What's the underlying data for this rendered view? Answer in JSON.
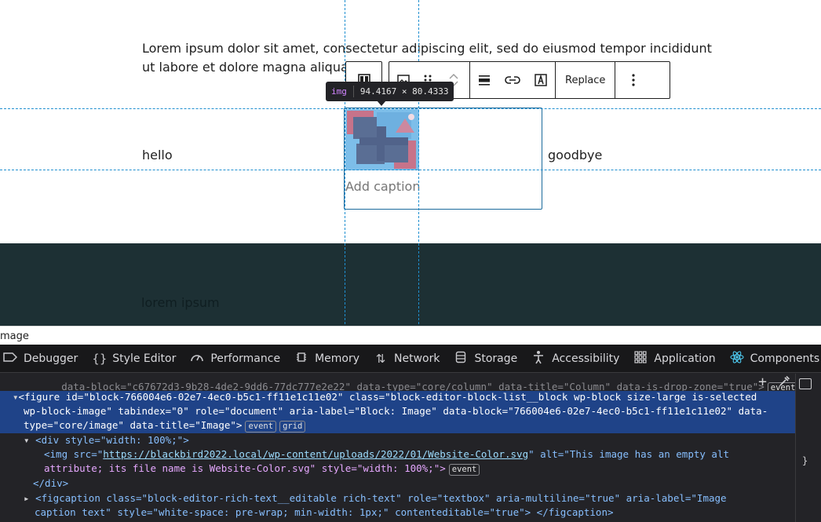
{
  "editor": {
    "paragraph": "Lorem ipsum dolor sit amet, consectetur adipiscing elit, sed do eiusmod tempor incididunt ut labore et dolore magna aliqua.",
    "left_column_text": "hello",
    "right_column_text": "goodbye",
    "caption_placeholder": "Add caption",
    "footer_text": "lorem ipsum",
    "breadcrumb": "mage"
  },
  "toolbar": {
    "replace_label": "Replace",
    "icons": [
      "column-icon",
      "image-icon",
      "drag-handle-icon",
      "move-up-icon",
      "move-down-icon",
      "align-icon",
      "link-icon",
      "text-overlay-icon",
      "more-options-icon"
    ]
  },
  "inspector_tooltip": {
    "tag": "img",
    "dimensions": "94.4167 × 80.4333"
  },
  "devtools": {
    "tabs": [
      {
        "icon": "debugger-icon",
        "label": "Debugger"
      },
      {
        "icon": "style-editor-icon",
        "label": "Style Editor"
      },
      {
        "icon": "performance-icon",
        "label": "Performance"
      },
      {
        "icon": "memory-icon",
        "label": "Memory"
      },
      {
        "icon": "network-icon",
        "label": "Network"
      },
      {
        "icon": "storage-icon",
        "label": "Storage"
      },
      {
        "icon": "accessibility-icon",
        "label": "Accessibility"
      },
      {
        "icon": "application-icon",
        "label": "Application"
      },
      {
        "icon": "react-icon",
        "label": "Components"
      }
    ],
    "code": {
      "line0": "data-block=\"c67672d3-9b28-4de2-9dd6-77dc777e2e22\" data-type=\"core/column\" data-title=\"Column\" data-is-drop-zone=\"true\">",
      "line0_badge": "event",
      "figure_tag": "<figure",
      "figure_attrs1": " id=\"block-766004e6-02e7-4ec0-b5c1-ff11e1c11e02\" class=\"block-editor-block-list__block wp-block size-large is-selected",
      "figure_attrs2": "wp-block-image\" tabindex=\"0\" role=\"document\" aria-label=\"Block: Image\" data-block=\"766004e6-02e7-4ec0-b5c1-ff11e1c11e02\" data-",
      "figure_attrs3": "type=\"core/image\" data-title=\"Image\">",
      "figure_badge1": "event",
      "figure_badge2": "grid",
      "div_open": "<div style=\"width: 100%;\">",
      "img_pre": "<img src=\"",
      "img_src": "https://blackbird2022.local/wp-content/uploads/2022/01/Website-Color.svg",
      "img_post": "\" alt=\"This image has an empty alt",
      "img_line2": "attribute; its file name is Website-Color.svg\" style=\"width: 100%;\">",
      "img_badge": "event",
      "div_close": "</div>",
      "figcaption": "<figcaption class=\"block-editor-rich-text__editable rich-text\" role=\"textbox\" aria-multiline=\"true\" aria-label=\"Image",
      "figcaption2": "caption text\" style=\"white-space: pre-wrap; min-width: 1px;\" contenteditable=\"true\"> </figcaption>"
    },
    "tools": [
      "add-node-icon",
      "eyedropper-icon"
    ]
  },
  "colors": {
    "selection_blue": "#1f4388",
    "guide_blue": "#1f8fd0",
    "dark_band": "#1d3034",
    "devtools_bg": "#232327"
  }
}
